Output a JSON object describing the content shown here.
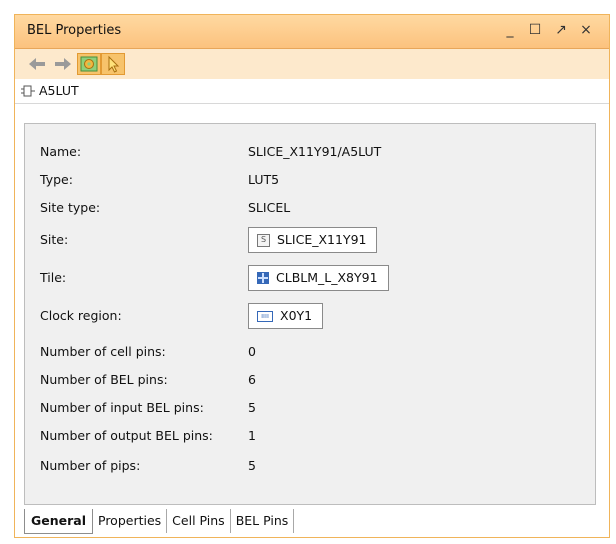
{
  "window": {
    "title": "BEL Properties",
    "controls": {
      "minimize": "_",
      "maximize": "☐",
      "restore": "↗",
      "close": "×"
    }
  },
  "toolbar": {
    "back_icon": "arrow-left-icon",
    "forward_icon": "arrow-right-icon",
    "settings_icon": "gear-icon",
    "select_icon": "cursor-icon"
  },
  "bel": {
    "name": "A5LUT",
    "icon": "lut-icon"
  },
  "general": {
    "name_label": "Name:",
    "name_value": "SLICE_X11Y91/A5LUT",
    "type_label": "Type:",
    "type_value": "LUT5",
    "site_type_label": "Site type:",
    "site_type_value": "SLICEL",
    "site_label": "Site:",
    "site_value": "SLICE_X11Y91",
    "tile_label": "Tile:",
    "tile_value": "CLBLM_L_X8Y91",
    "clock_region_label": "Clock region:",
    "clock_region_value": "X0Y1",
    "cell_pins_label": "Number of cell pins:",
    "cell_pins_value": "0",
    "bel_pins_label": "Number of BEL pins:",
    "bel_pins_value": "6",
    "input_bel_pins_label": "Number of input BEL pins:",
    "input_bel_pins_value": "5",
    "output_bel_pins_label": "Number of output BEL pins:",
    "output_bel_pins_value": "1",
    "pips_label": "Number of pips:",
    "pips_value": "5"
  },
  "tabs": [
    "General",
    "Properties",
    "Cell Pins",
    "BEL Pins"
  ],
  "colors": {
    "title_bg": "#fcc27e",
    "toolbar_bg": "#fde9cc",
    "accent": "#f7c36b",
    "site_icon": "#3568b8"
  }
}
